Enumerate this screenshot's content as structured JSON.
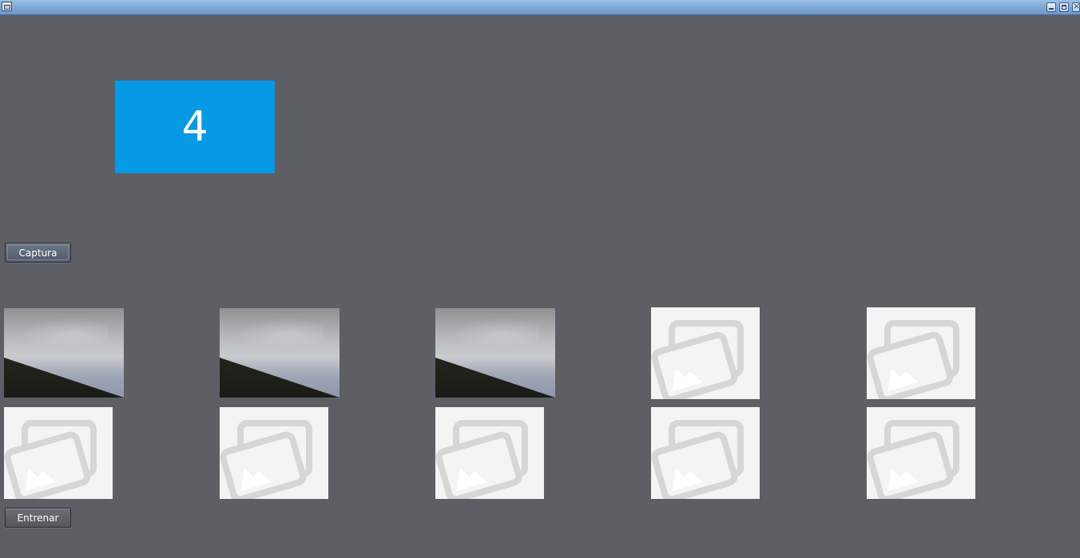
{
  "window": {
    "title": "",
    "controls": [
      "minimize-icon",
      "maximize-icon",
      "close-icon"
    ]
  },
  "counter": {
    "value": "4",
    "color": "#0599e6"
  },
  "buttons": {
    "capture_label": "Captura",
    "train_label": "Entrenar"
  },
  "gallery": {
    "rows": [
      [
        "photo",
        "photo",
        "photo",
        "empty",
        "empty"
      ],
      [
        "empty",
        "empty",
        "empty",
        "empty",
        "empty"
      ]
    ]
  },
  "colors": {
    "background": "#5e5f64",
    "placeholder_bg": "#f4f4f4",
    "accent": "#0599e6"
  }
}
